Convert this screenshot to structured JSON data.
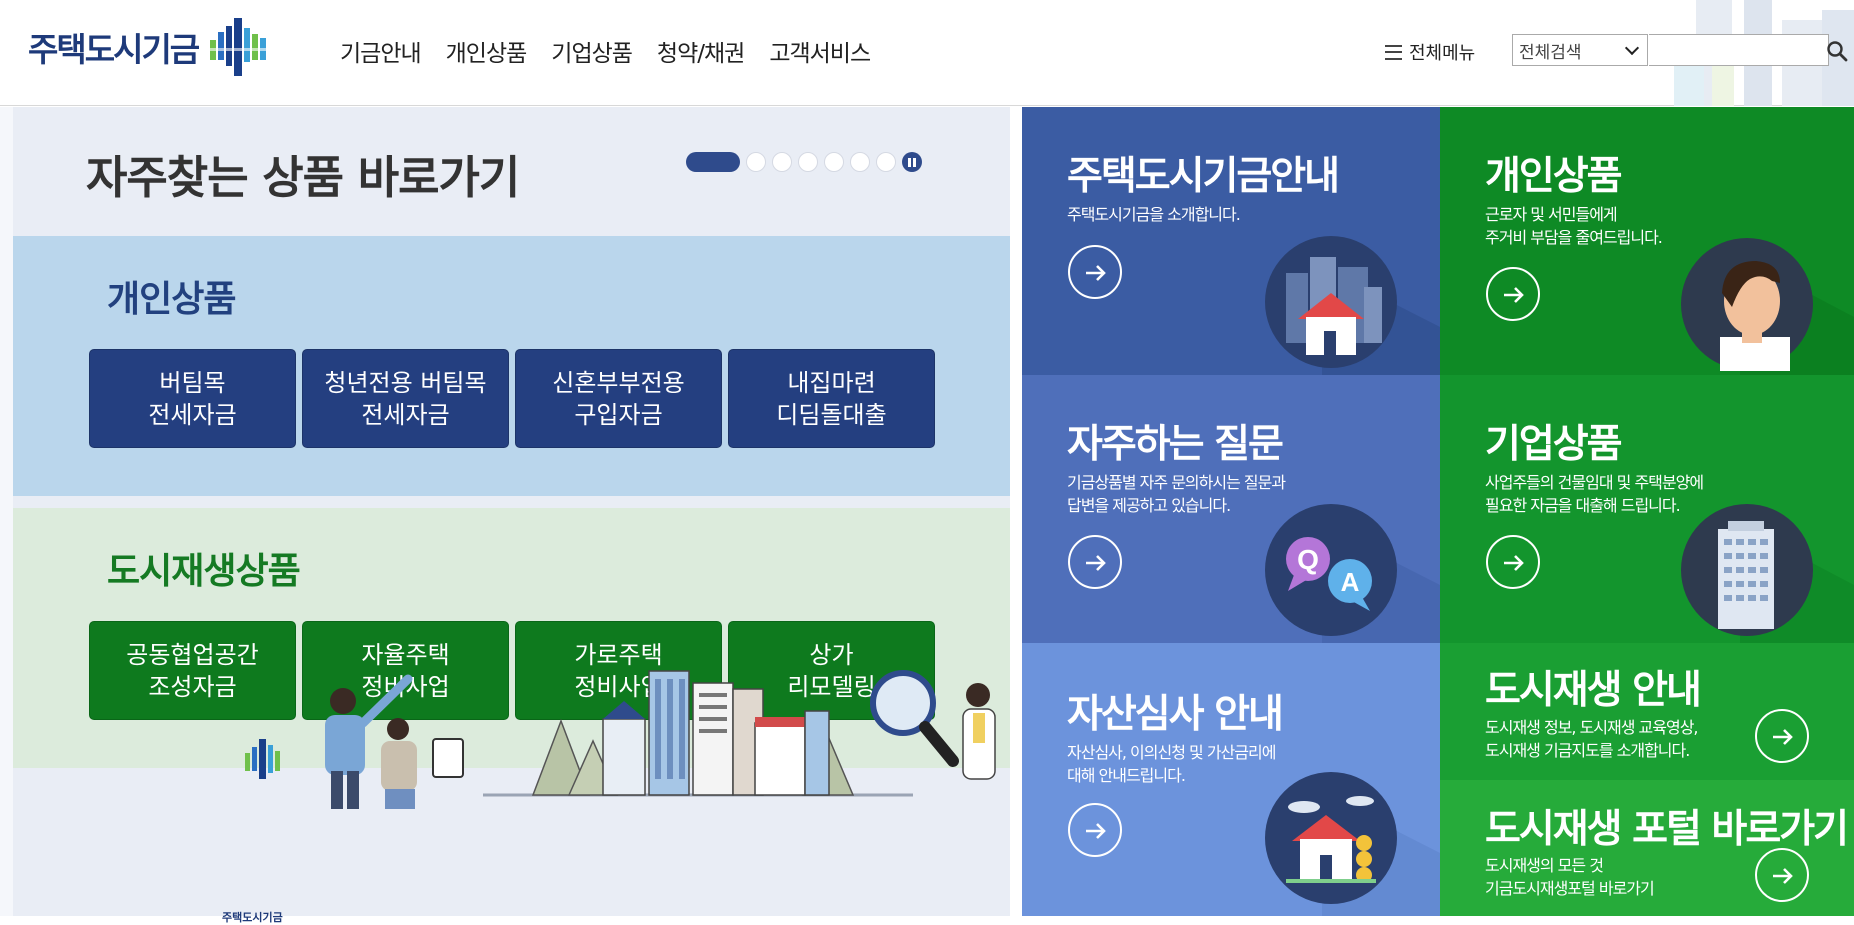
{
  "header": {
    "logo_text": "주택도시기금",
    "nav": [
      "기금안내",
      "개인상품",
      "기업상품",
      "청약/채권",
      "고객서비스"
    ],
    "all_menu_label": "전체메뉴",
    "search": {
      "scope_selected": "전체검색",
      "placeholder": ""
    }
  },
  "shortcuts": {
    "title": "자주찾는 상품 바로가기",
    "pager": {
      "pages": 8,
      "active_page": 1
    },
    "personal": {
      "title": "개인상품",
      "buttons": [
        {
          "line1": "버팀목",
          "line2": "전세자금"
        },
        {
          "line1": "청년전용 버팀목",
          "line2": "전세자금"
        },
        {
          "line1": "신혼부부전용",
          "line2": "구입자금"
        },
        {
          "line1": "내집마련",
          "line2": "디딤돌대출"
        }
      ]
    },
    "urban": {
      "title": "도시재생상품",
      "buttons": [
        {
          "line1": "공동협업공간",
          "line2": "조성자금"
        },
        {
          "line1": "자율주택",
          "line2": "정비사업"
        },
        {
          "line1": "가로주택",
          "line2": "정비사업"
        },
        {
          "line1": "상가",
          "line2": "리모델링"
        }
      ]
    },
    "illustration_logo_text": "주택도시기금"
  },
  "tiles": [
    {
      "title": "주택도시기금안내",
      "desc1": "주택도시기금을 소개합니다.",
      "desc2": "",
      "color": "#3b5ca3",
      "icon": "city-house-icon"
    },
    {
      "title": "개인상품",
      "desc1": "근로자 및 서민들에게",
      "desc2": "주거비 부담을 줄여드립니다.",
      "color": "#0e8a25",
      "icon": "person-icon"
    },
    {
      "title": "자주하는 질문",
      "desc1": "기금상품별 자주 문의하시는 질문과",
      "desc2": "답변을 제공하고 있습니다.",
      "color": "#4f6fba",
      "icon": "qa-bubbles-icon"
    },
    {
      "title": "기업상품",
      "desc1": "사업주들의 건물임대 및 주택분양에",
      "desc2": "필요한 자금을 대출해 드립니다.",
      "color": "#13952d",
      "icon": "building-icon"
    },
    {
      "title": "자산심사 안내",
      "desc1": "자산심사, 이의신청 및 가산금리에",
      "desc2": "대해 안내드립니다.",
      "color": "#6c93dc",
      "icon": "house-coins-icon"
    },
    {
      "title": "도시재생 안내",
      "desc1": "도시재생 정보, 도시재생 교육영상,",
      "desc2": "도시재생 기금지도를 소개합니다.",
      "color": "#1a9f33",
      "icon": "arrow-icon"
    },
    {
      "title": "도시재생 포털 바로가기",
      "desc1": "도시재생의 모든 것",
      "desc2": "기금도시재생포털 바로가기",
      "color": "#26ab3a",
      "icon": "arrow-icon"
    }
  ]
}
